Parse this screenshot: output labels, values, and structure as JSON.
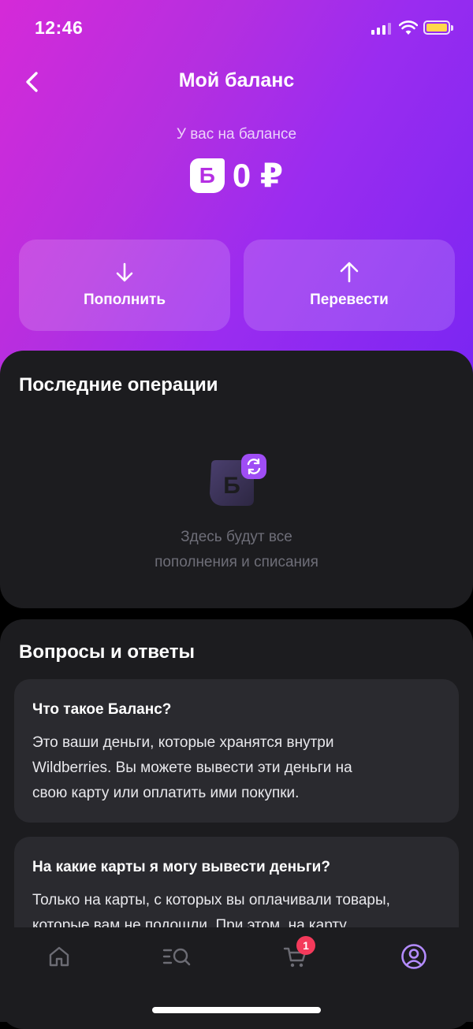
{
  "status_bar": {
    "time": "12:46"
  },
  "header": {
    "title": "Мой баланс"
  },
  "balance": {
    "label": "У вас на балансе",
    "logo_letter": "Б",
    "amount": "0 ₽"
  },
  "actions": [
    {
      "label": "Пополнить",
      "icon": "arrow-down-icon"
    },
    {
      "label": "Перевести",
      "icon": "arrow-up-icon"
    }
  ],
  "operations": {
    "title": "Последние операции",
    "empty_icon_letter": "Б",
    "empty_line1": "Здесь будут все",
    "empty_line2": "пополнения и списания"
  },
  "faq": {
    "title": "Вопросы и ответы",
    "items": [
      {
        "question": "Что такое Баланс?",
        "answer_lines": [
          "Это ваши деньги, которые хранятся внутри",
          "Wildberries. Вы можете вывести эти деньги на",
          "свою карту или оплатить ими покупки."
        ]
      },
      {
        "question": "На какие карты я могу вывести деньги?",
        "answer_lines": [
          "Только на карты, с которых вы оплачивали товары,",
          "которые вам не подошли. При этом, на карту"
        ]
      }
    ]
  },
  "tabbar": {
    "items": [
      "home-icon",
      "catalog-search-icon",
      "cart-icon",
      "profile-icon"
    ],
    "cart_badge": "1",
    "active_color": "#b48cff"
  },
  "colors": {
    "gradient_start": "#d52ad8",
    "gradient_end": "#7a26f2",
    "card_bg": "#1c1c1f",
    "badge": "#f43a5b"
  }
}
